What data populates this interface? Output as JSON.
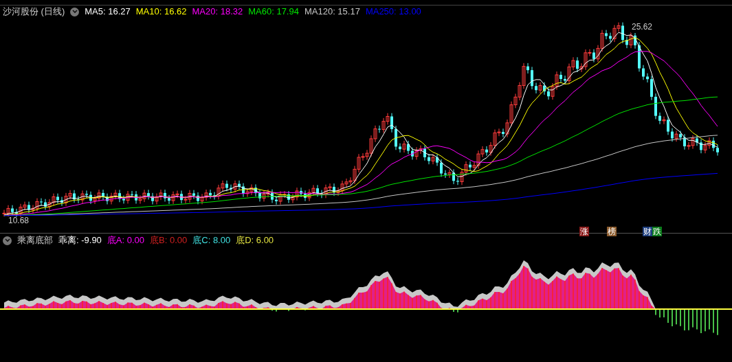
{
  "main_chart": {
    "title": "沙河股份 (日线)",
    "legend": [
      {
        "label": "MA5: 16.27",
        "color": "#ffffff"
      },
      {
        "label": "MA10: 16.62",
        "color": "#ffff00"
      },
      {
        "label": "MA20: 18.32",
        "color": "#ff00ff"
      },
      {
        "label": "MA60: 17.94",
        "color": "#00e600"
      },
      {
        "label": "MA120: 15.17",
        "color": "#c8c8c8"
      },
      {
        "label": "MA250: 13.00",
        "color": "#0000ff"
      }
    ],
    "high_label": "25.62",
    "low_label": "10.68",
    "events": [
      {
        "label": "涨",
        "color": "#8b1a1a"
      },
      {
        "label": "榜",
        "color": "#8b5a2b"
      },
      {
        "label": "财",
        "color": "#1f3f7f"
      },
      {
        "label": "跌",
        "color": "#0a7a1a"
      }
    ]
  },
  "indicator": {
    "title": "乘离底部",
    "values": [
      {
        "label": "乖离: -9.90",
        "color": "#ffffff"
      },
      {
        "label": "底A: 0.00",
        "color": "#ff00ff"
      },
      {
        "label": "底B: 0.00",
        "color": "#d02020"
      },
      {
        "label": "底C: 8.00",
        "color": "#40e0e0"
      },
      {
        "label": "底D: 6.00",
        "color": "#e0e040"
      }
    ]
  }
}
